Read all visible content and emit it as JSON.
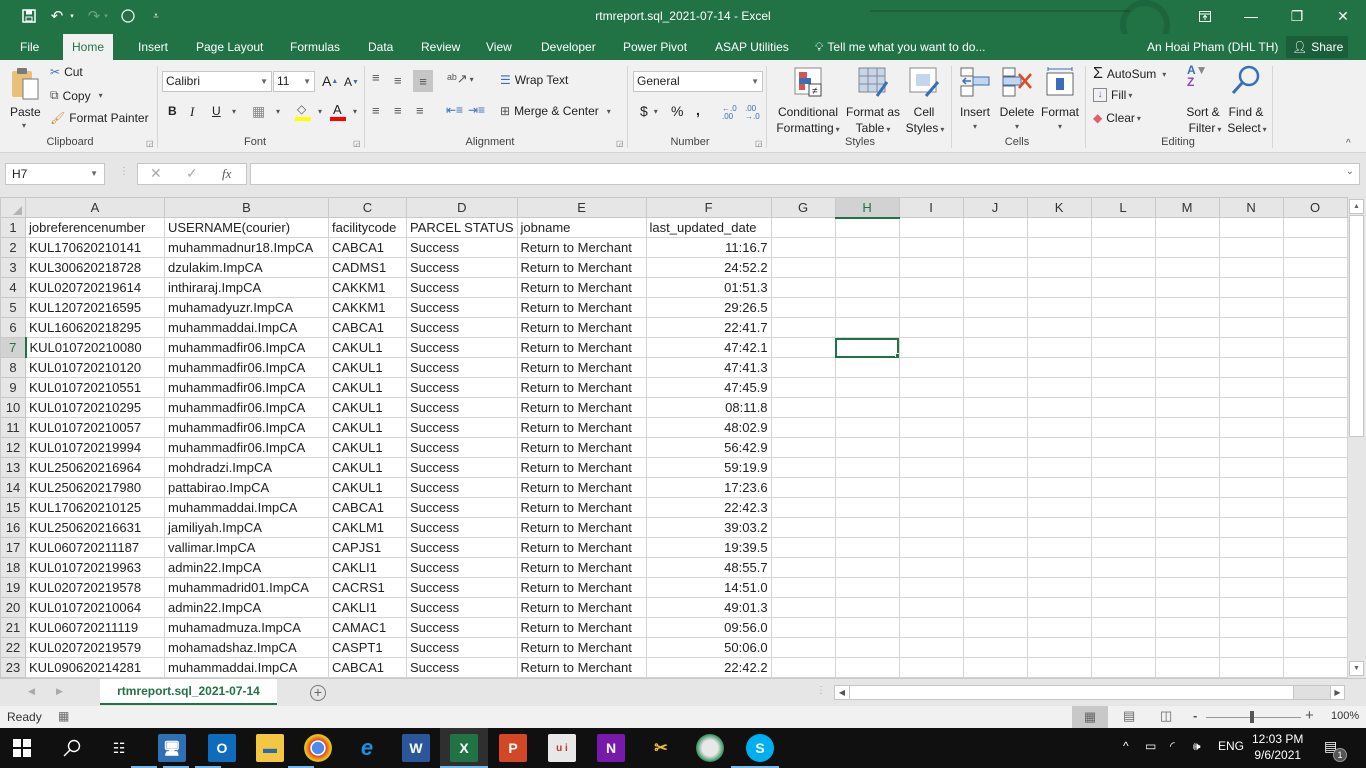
{
  "window": {
    "title": "rtmreport.sql_2021-07-14 - Excel",
    "controls": {
      "ribbon_display": "⊡",
      "minimize": "—",
      "restore": "❐",
      "close": "✕"
    }
  },
  "quick_access": {
    "save_icon": "save-icon",
    "undo_icon": "undo-icon",
    "redo_icon": "redo-icon",
    "circle_icon": "touch-mode-icon",
    "customize": "customize-qat"
  },
  "ribbon_tabs": [
    "File",
    "Home",
    "Insert",
    "Page Layout",
    "Formulas",
    "Data",
    "Review",
    "View",
    "Developer",
    "Power Pivot",
    "ASAP Utilities"
  ],
  "active_tab": "Home",
  "tell_me": "Tell me what you want to do...",
  "user": "An Hoai Pham (DHL TH)",
  "share": "Share",
  "ribbon": {
    "clipboard": {
      "label": "Clipboard",
      "paste": "Paste",
      "cut": "Cut",
      "copy": "Copy",
      "format_painter": "Format Painter"
    },
    "font": {
      "label": "Font",
      "name": "Calibri",
      "size": "11",
      "bold": "B",
      "italic": "I",
      "underline": "U",
      "grow": "A",
      "shrink": "A",
      "highlight_color": "#ffff00",
      "font_color": "#ff0000"
    },
    "alignment": {
      "label": "Alignment",
      "wrap_text": "Wrap Text",
      "merge_center": "Merge & Center"
    },
    "number": {
      "label": "Number",
      "format": "General",
      "currency": "$",
      "percent": "%",
      "comma": ",",
      "inc_decimal": "←.0 .00",
      "dec_decimal": ".00 →.0"
    },
    "styles": {
      "label": "Styles",
      "conditional_formatting": [
        "Conditional",
        "Formatting"
      ],
      "format_as_table": [
        "Format as",
        "Table"
      ],
      "cell_styles": [
        "Cell",
        "Styles"
      ]
    },
    "cells": {
      "label": "Cells",
      "insert": "Insert",
      "delete": "Delete",
      "format": "Format"
    },
    "editing": {
      "label": "Editing",
      "autosum": "AutoSum",
      "fill": "Fill",
      "clear": "Clear",
      "sort_filter": [
        "Sort &",
        "Filter"
      ],
      "find_select": [
        "Find &",
        "Select"
      ]
    }
  },
  "formula_bar": {
    "name_box": "H7",
    "cancel": "✕",
    "enter": "✓",
    "fx": "fx",
    "value": ""
  },
  "columns": [
    "A",
    "B",
    "C",
    "D",
    "E",
    "F",
    "G",
    "H",
    "I",
    "J",
    "K",
    "L",
    "M",
    "N",
    "O"
  ],
  "selected_cell": {
    "column": "H",
    "row": 7
  },
  "sheet": {
    "headers": [
      "jobreferencenumber",
      "USERNAME(courier)",
      "facilitycode",
      "PARCEL STATUS",
      "jobname",
      "last_updated_date"
    ],
    "rows": [
      [
        "KUL170620210141",
        "muhammadnur18.ImpCA",
        "CABCA1",
        "Success",
        "Return to Merchant",
        "11:16.7"
      ],
      [
        "KUL300620218728",
        "dzulakim.ImpCA",
        "CADMS1",
        "Success",
        "Return to Merchant",
        "24:52.2"
      ],
      [
        "KUL020720219614",
        "inthiraraj.ImpCA",
        "CAKKM1",
        "Success",
        "Return to Merchant",
        "01:51.3"
      ],
      [
        "KUL120720216595",
        "muhamadyuzr.ImpCA",
        "CAKKM1",
        "Success",
        "Return to Merchant",
        "29:26.5"
      ],
      [
        "KUL160620218295",
        "muhammaddai.ImpCA",
        "CABCA1",
        "Success",
        "Return to Merchant",
        "22:41.7"
      ],
      [
        "KUL010720210080",
        "muhammadfir06.ImpCA",
        "CAKUL1",
        "Success",
        "Return to Merchant",
        "47:42.1"
      ],
      [
        "KUL010720210120",
        "muhammadfir06.ImpCA",
        "CAKUL1",
        "Success",
        "Return to Merchant",
        "47:41.3"
      ],
      [
        "KUL010720210551",
        "muhammadfir06.ImpCA",
        "CAKUL1",
        "Success",
        "Return to Merchant",
        "47:45.9"
      ],
      [
        "KUL010720210295",
        "muhammadfir06.ImpCA",
        "CAKUL1",
        "Success",
        "Return to Merchant",
        "08:11.8"
      ],
      [
        "KUL010720210057",
        "muhammadfir06.ImpCA",
        "CAKUL1",
        "Success",
        "Return to Merchant",
        "48:02.9"
      ],
      [
        "KUL010720219994",
        "muhammadfir06.ImpCA",
        "CAKUL1",
        "Success",
        "Return to Merchant",
        "56:42.9"
      ],
      [
        "KUL250620216964",
        "mohdradzi.ImpCA",
        "CAKUL1",
        "Success",
        "Return to Merchant",
        "59:19.9"
      ],
      [
        "KUL250620217980",
        "pattabirao.ImpCA",
        "CAKUL1",
        "Success",
        "Return to Merchant",
        "17:23.6"
      ],
      [
        "KUL170620210125",
        "muhammaddai.ImpCA",
        "CABCA1",
        "Success",
        "Return to Merchant",
        "22:42.3"
      ],
      [
        "KUL250620216631",
        "jamiliyah.ImpCA",
        "CAKLM1",
        "Success",
        "Return to Merchant",
        "39:03.2"
      ],
      [
        "KUL060720211187",
        "vallimar.ImpCA",
        "CAPJS1",
        "Success",
        "Return to Merchant",
        "19:39.5"
      ],
      [
        "KUL010720219963",
        "admin22.ImpCA",
        "CAKLI1",
        "Success",
        "Return to Merchant",
        "48:55.7"
      ],
      [
        "KUL020720219578",
        "muhammadrid01.ImpCA",
        "CACRS1",
        "Success",
        "Return to Merchant",
        "14:51.0"
      ],
      [
        "KUL010720210064",
        "admin22.ImpCA",
        "CAKLI1",
        "Success",
        "Return to Merchant",
        "49:01.3"
      ],
      [
        "KUL060720211119",
        "muhamadmuza.ImpCA",
        "CAMAC1",
        "Success",
        "Return to Merchant",
        "09:56.0"
      ],
      [
        "KUL020720219579",
        "mohamadshaz.ImpCA",
        "CASPT1",
        "Success",
        "Return to Merchant",
        "50:06.0"
      ],
      [
        "KUL090620214281",
        "muhammaddai.ImpCA",
        "CABCA1",
        "Success",
        "Return to Merchant",
        "22:42.2"
      ]
    ]
  },
  "sheet_tabs": [
    "rtmreport.sql_2021-07-14"
  ],
  "active_sheet": "rtmreport.sql_2021-07-14",
  "status": {
    "mode": "Ready",
    "zoom": "100%",
    "zoom_minus": "-",
    "zoom_plus": "+"
  },
  "taskbar": {
    "apps": [
      "start",
      "search",
      "task-view",
      "network-computer",
      "outlook",
      "file-explorer",
      "chrome",
      "internet-explorer",
      "word",
      "excel",
      "powerpoint",
      "unikey",
      "onenote",
      "tool",
      "globe",
      "skype"
    ],
    "app_glyphs": {
      "word": "W",
      "excel": "X",
      "powerpoint": "P",
      "onenote": "N",
      "outlook": "O",
      "skype": "S",
      "ie": "e"
    },
    "language": "ENG",
    "time": "12:03 PM",
    "date": "9/6/2021",
    "notifications": "1"
  }
}
